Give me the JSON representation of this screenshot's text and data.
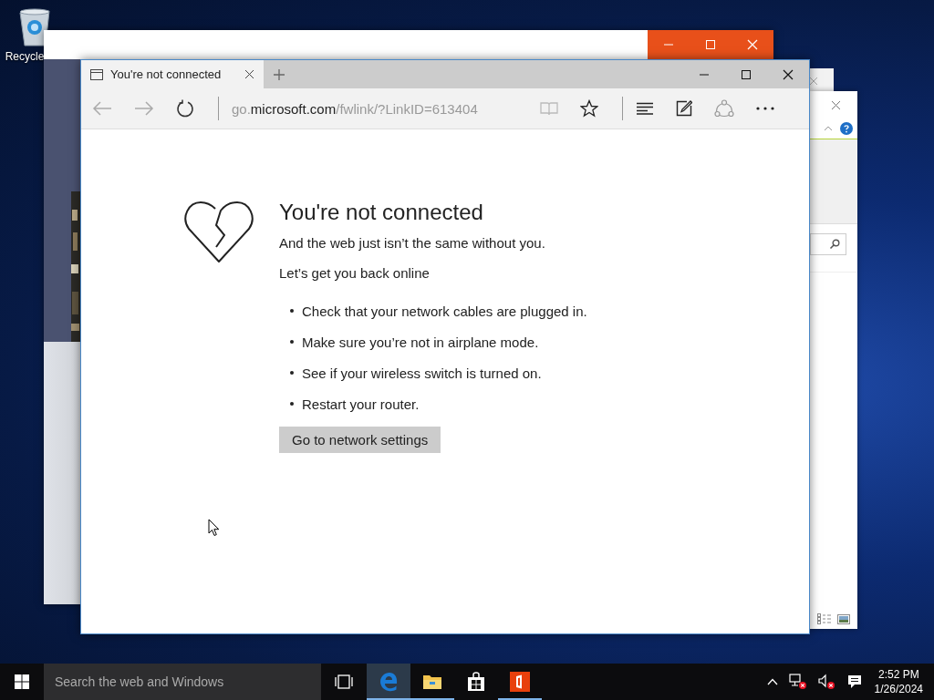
{
  "desktop": {
    "icons": [
      {
        "label": "Recycle"
      }
    ]
  },
  "browser": {
    "tabs": [
      {
        "title": "You're not connected",
        "selected": true
      }
    ],
    "address": [
      {
        "text": "go.",
        "emphasis": false
      },
      {
        "text": "microsoft.com",
        "emphasis": true
      },
      {
        "text": "/fwlink/?LinkID=613404",
        "emphasis": false
      }
    ],
    "favorite": false
  },
  "page": {
    "heading": "You're not connected",
    "lines": [
      "And the web just isn’t the same without you.",
      "Let’s get you back online"
    ],
    "bullets": [
      "Check that your network cables are plugged in.",
      "Make sure you’re not in airplane mode.",
      "See if your wireless switch is turned on.",
      "Restart your router."
    ],
    "button": "Go to network settings"
  },
  "taskbar": {
    "search": {
      "placeholder": "Search the web and Windows"
    },
    "apps": [
      {
        "kind": "edge",
        "selected": true,
        "running": true
      },
      {
        "kind": "explorer",
        "selected": false,
        "running": true
      },
      {
        "kind": "store",
        "selected": false,
        "running": false
      },
      {
        "kind": "office",
        "selected": false,
        "running": true
      }
    ],
    "clock": {
      "time": "2:52 PM",
      "date": "1/26/2024"
    }
  }
}
